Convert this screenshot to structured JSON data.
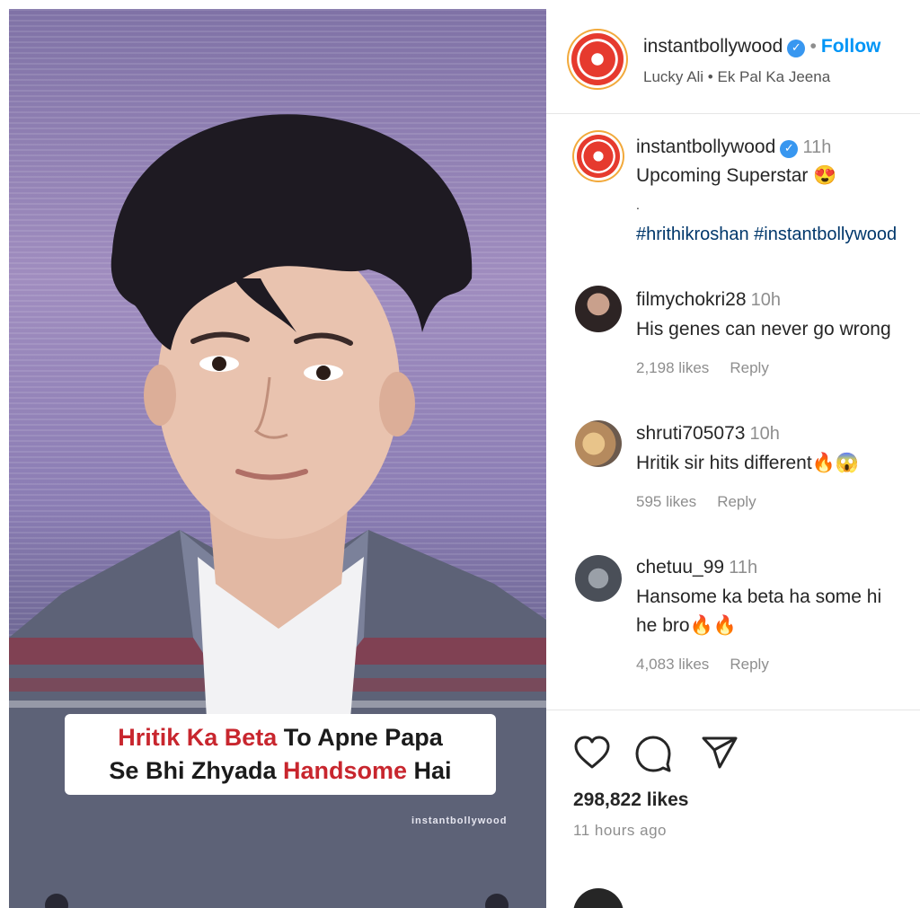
{
  "media": {
    "caption_line1_red": "Hritik Ka Beta",
    "caption_line1_rest": " To Apne Papa",
    "caption_line2_start": "Se Bhi Zhyada ",
    "caption_line2_red": "Handsome",
    "caption_line2_end": " Hai",
    "watermark": "instantbollywood"
  },
  "header": {
    "username": "instantbollywood",
    "separator": "•",
    "follow_label": "Follow",
    "audio": "Lucky Ali • Ek Pal Ka Jeena",
    "verified_glyph": "✓"
  },
  "post_caption": {
    "username": "instantbollywood",
    "time": "11h",
    "text": "Upcoming Superstar",
    "emoji": "😍",
    "dot": ".",
    "hashtags": "#hrithikroshan #instantbollywood"
  },
  "comments": [
    {
      "username": "filmychokri28",
      "time": "10h",
      "text": "His genes can never go wrong",
      "likes": "2,198 likes",
      "reply": "Reply"
    },
    {
      "username": "shruti705073",
      "time": "10h",
      "text": "Hritik sir hits different🔥😱",
      "likes": "595 likes",
      "reply": "Reply"
    },
    {
      "username": "chetuu_99",
      "time": "11h",
      "text_line1": "Hansome ka beta ha some hi",
      "text_line2": "he bro🔥🔥",
      "likes": "4,083 likes",
      "reply": "Reply"
    }
  ],
  "actions": {
    "likes": "298,822 likes",
    "posted": "11 hours ago"
  },
  "icons": [
    "heart-icon",
    "comment-icon",
    "share-icon",
    "verified-badge-icon"
  ],
  "colors": {
    "accent_blue": "#0095f6",
    "caption_red": "#c8262e",
    "verified": "#3897f0"
  }
}
